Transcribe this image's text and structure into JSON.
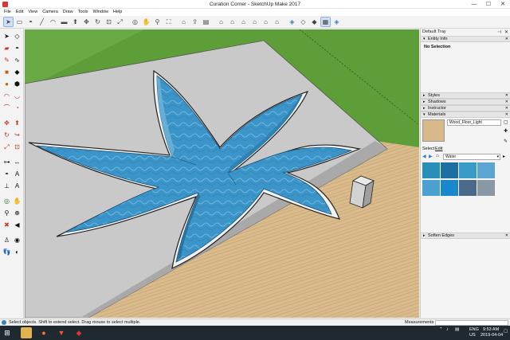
{
  "window": {
    "title": "Curation Corner - SketchUp Make 2017",
    "minimize_icon": "minimize-icon",
    "maximize_icon": "maximize-icon",
    "close_icon": "close-icon"
  },
  "menu": [
    "File",
    "Edit",
    "View",
    "Camera",
    "Draw",
    "Tools",
    "Window",
    "Help"
  ],
  "toolbar_icons": [
    "select-icon",
    "eraser-icon",
    "paint-bucket-icon",
    "line-icon",
    "arc-icon",
    "rectangle-icon",
    "push-pull-icon",
    "move-icon",
    "rotate-icon",
    "offset-icon",
    "scale-icon",
    "orbit-icon",
    "pan-icon",
    "zoom-icon",
    "zoom-extents-icon",
    "warehouse-icon",
    "share-model-icon",
    "extension-warehouse-icon",
    "iso-view-icon",
    "top-view-icon",
    "front-view-icon",
    "right-view-icon",
    "back-view-icon",
    "left-view-icon",
    "xray-icon",
    "shaded-icon",
    "textured-icon"
  ],
  "tray": {
    "title": "Default Tray",
    "panels": {
      "entity_info": "Entity Info",
      "no_selection": "No Selection",
      "styles": "Styles",
      "shadows": "Shadows",
      "instructor": "Instructor",
      "materials": "Materials",
      "soften_edges": "Soften Edges"
    },
    "materials": {
      "current_name": "Wood_Floor_Light",
      "tab_select": "Select",
      "tab_edit": "Edit",
      "library": "Water",
      "swatch_colors": [
        "#2a8fb8",
        "#1d6fa3",
        "#5aa5d2",
        "#3a9ac8",
        "#2d7fb0",
        "#1a86cc",
        "#4b6a8a",
        "#8a97a5"
      ]
    }
  },
  "status": {
    "message": "Select objects. Shift to extend select. Drag mouse to select multiple.",
    "measurements_label": "Measurements"
  },
  "taskbar": {
    "language": "ENG",
    "region": "US",
    "time": "9:53 AM",
    "date": "2019-04-04"
  },
  "colors": {
    "grass": "#5f9e3a",
    "water": "#3c95c9",
    "concrete": "#c8c8c8",
    "wood": "#d8b88a",
    "accent": "#2f6fbf"
  }
}
